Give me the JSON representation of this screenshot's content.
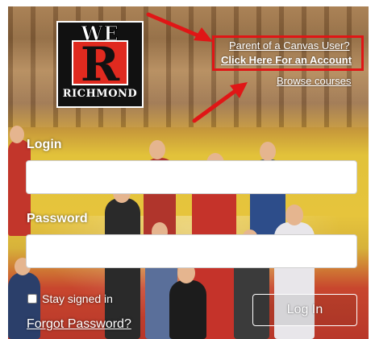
{
  "logo": {
    "top_text": "WE",
    "letter": "R",
    "bottom_text": "RICHMOND"
  },
  "links": {
    "parent_line": "Parent of a Canvas User?",
    "create_account": "Click Here For an Account",
    "browse": "Browse courses"
  },
  "form": {
    "login_label": "Login",
    "login_value": "",
    "password_label": "Password",
    "password_value": "",
    "stay_signed_in": "Stay signed in",
    "forgot_password": "Forgot Password?",
    "login_button": "Log In"
  },
  "colors": {
    "annotation_red": "#e01616",
    "logo_red": "#e02a1f"
  },
  "icons": [
    "annotation-arrow-icon",
    "annotation-arrow-icon"
  ]
}
